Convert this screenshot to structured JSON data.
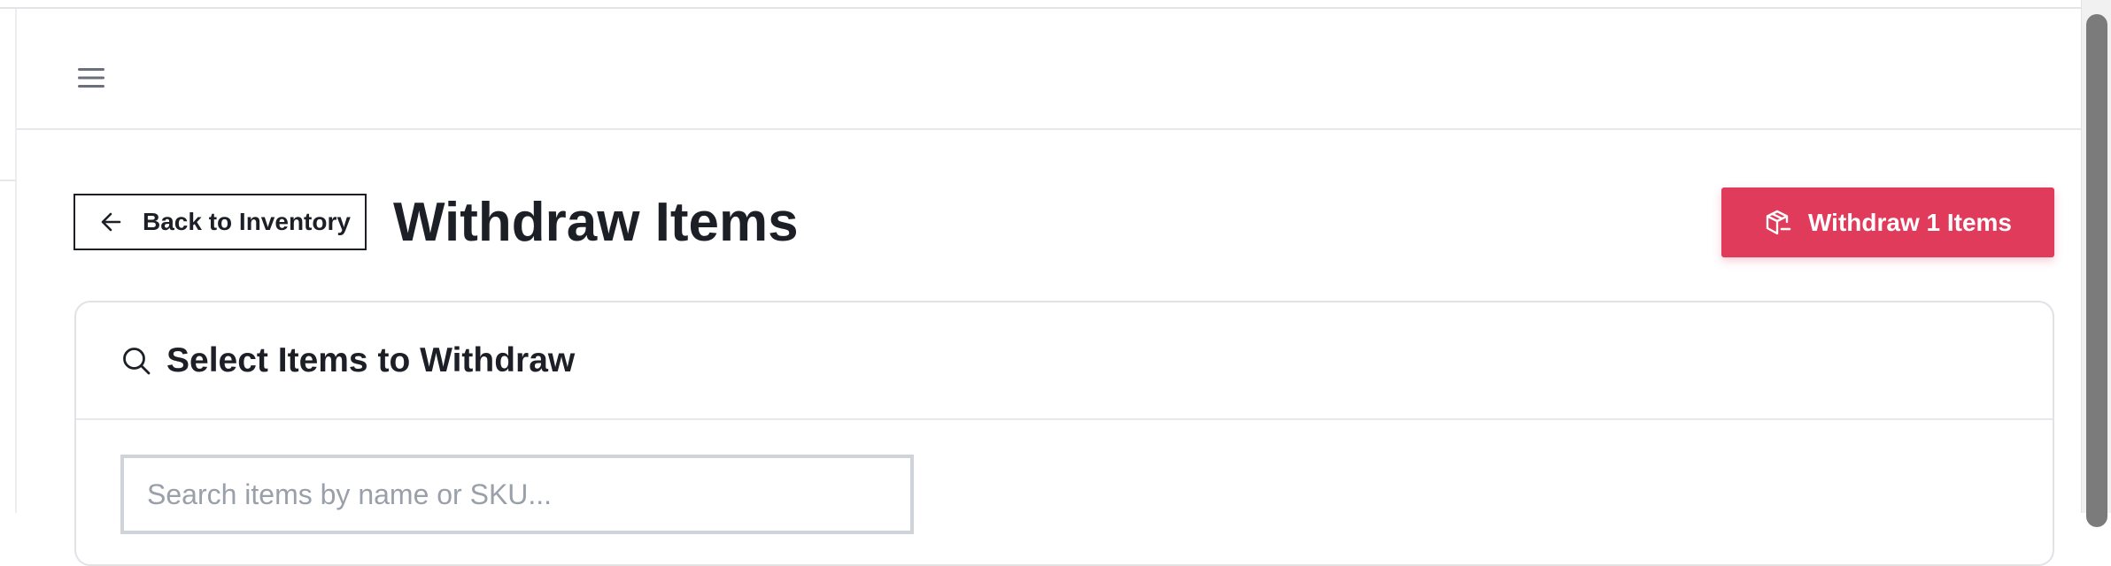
{
  "header": {
    "menu_icon": "hamburger-menu-icon"
  },
  "toolbar": {
    "back_label": "Back to Inventory",
    "back_icon": "arrow-left-icon",
    "page_title": "Withdraw Items",
    "withdraw_label": "Withdraw 1 Items",
    "withdraw_icon": "package-minus-icon",
    "accent_color": "#e03b5b"
  },
  "card": {
    "title": "Select Items to Withdraw",
    "title_icon": "search-icon",
    "search": {
      "placeholder": "Search items by name or SKU...",
      "value": ""
    }
  }
}
